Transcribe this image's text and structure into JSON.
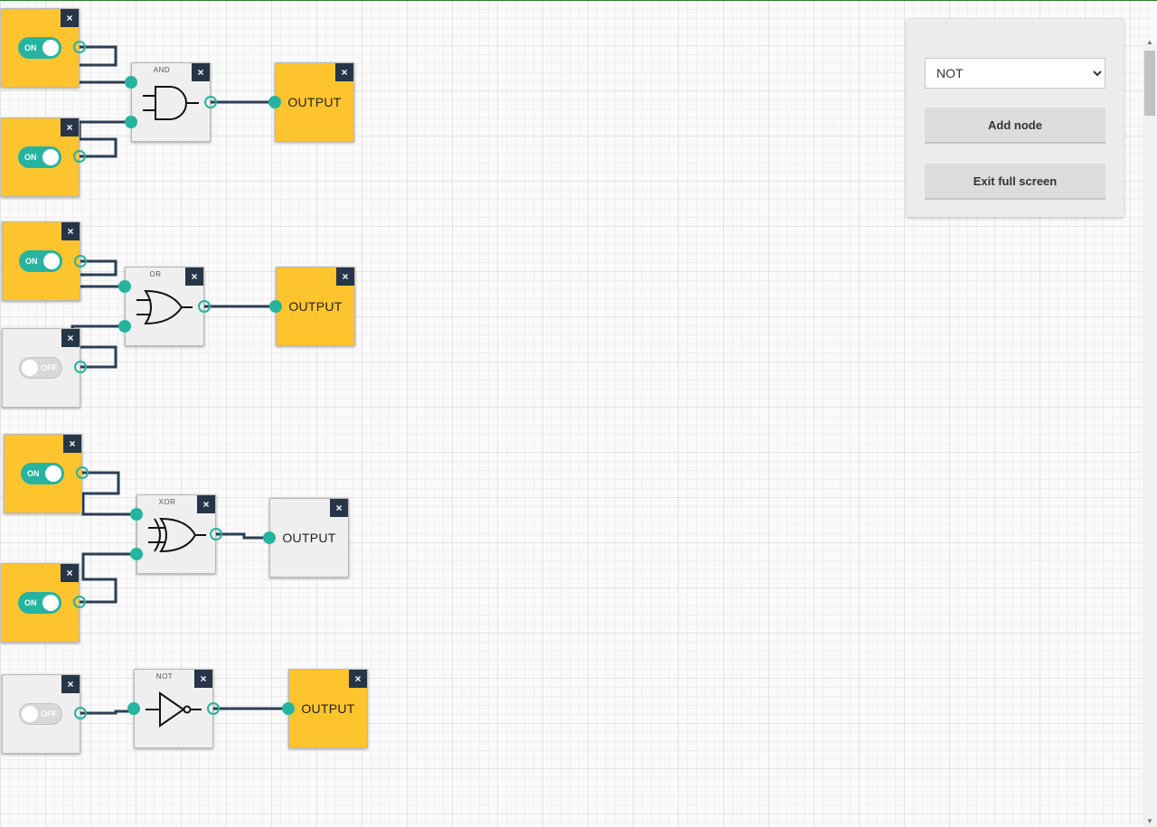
{
  "panel": {
    "select_value": "NOT",
    "select_options": [
      "NOT"
    ],
    "add_node_label": "Add node",
    "exit_fullscreen_label": "Exit full screen"
  },
  "close_label": "×",
  "toggle_on_label": "ON",
  "toggle_off_label": "OFF",
  "output_label": "OUTPUT",
  "gates": {
    "and": "AND",
    "or": "OR",
    "xor": "XOR",
    "not": "NOT"
  },
  "circuits": [
    {
      "gate": "AND",
      "inputs": [
        "ON",
        "ON"
      ],
      "output": "ON"
    },
    {
      "gate": "OR",
      "inputs": [
        "ON",
        "OFF"
      ],
      "output": "ON"
    },
    {
      "gate": "XOR",
      "inputs": [
        "ON",
        "ON"
      ],
      "output": "OFF"
    },
    {
      "gate": "NOT",
      "inputs": [
        "OFF"
      ],
      "output": "ON"
    }
  ],
  "colors": {
    "on_node": "#fec42d",
    "off_node": "#efefef",
    "toggle_on": "#26b4a0",
    "port": "#26b4a0",
    "wire": "#2b3f55",
    "close_button": "#263547"
  }
}
